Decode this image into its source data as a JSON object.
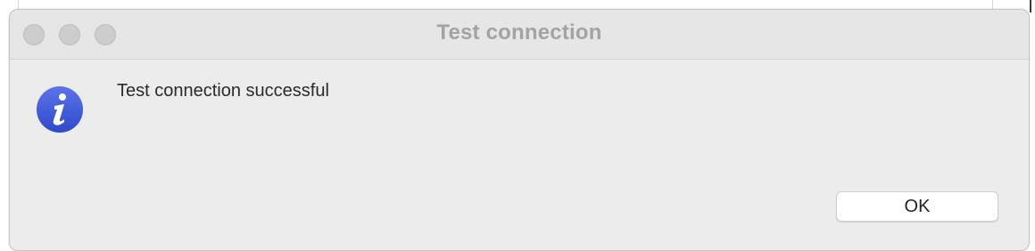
{
  "dialog": {
    "title": "Test connection",
    "message": "Test connection successful",
    "icon": "info-icon",
    "ok_label": "OK"
  },
  "colors": {
    "title_text": "#a3a3a3",
    "icon_blue": "#3f5bd8",
    "dialog_bg": "#ececec"
  }
}
